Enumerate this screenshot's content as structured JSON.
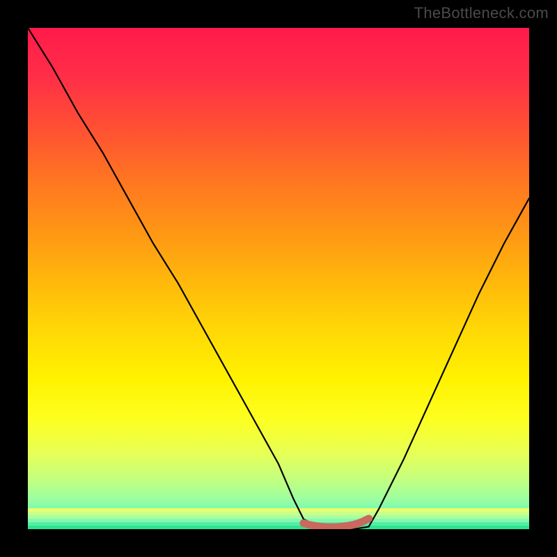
{
  "watermark": "TheBottleneck.com",
  "chart_data": {
    "type": "line",
    "title": "",
    "xlabel": "",
    "ylabel": "",
    "xlim": [
      0,
      100
    ],
    "ylim": [
      0,
      100
    ],
    "grid": false,
    "legend": false,
    "series": [
      {
        "name": "curve",
        "x": [
          0,
          5,
          10,
          15,
          20,
          25,
          30,
          35,
          40,
          45,
          50,
          53,
          55,
          58,
          60,
          62,
          65,
          68,
          70,
          75,
          80,
          85,
          90,
          95,
          100
        ],
        "values": [
          100,
          92,
          83,
          75,
          66,
          57,
          49,
          40,
          31,
          22,
          13,
          6,
          2,
          0.5,
          0,
          0,
          0,
          0.5,
          4,
          14,
          25,
          36,
          47,
          57,
          66
        ]
      },
      {
        "name": "flat-marker",
        "x": [
          55,
          56,
          57,
          58,
          59,
          60,
          61,
          62,
          63,
          64,
          65,
          66,
          67,
          68
        ],
        "values": [
          1.2,
          0.9,
          0.7,
          0.55,
          0.45,
          0.4,
          0.4,
          0.45,
          0.55,
          0.7,
          0.9,
          1.2,
          1.6,
          2.1
        ]
      }
    ],
    "gradient_bands": [
      {
        "stop": 0.0,
        "color": "#ff1a4b"
      },
      {
        "stop": 0.1,
        "color": "#ff2f47"
      },
      {
        "stop": 0.2,
        "color": "#ff5033"
      },
      {
        "stop": 0.3,
        "color": "#ff7422"
      },
      {
        "stop": 0.4,
        "color": "#ff9415"
      },
      {
        "stop": 0.5,
        "color": "#ffb60c"
      },
      {
        "stop": 0.6,
        "color": "#ffd706"
      },
      {
        "stop": 0.7,
        "color": "#fff200"
      },
      {
        "stop": 0.78,
        "color": "#fdff1f"
      },
      {
        "stop": 0.85,
        "color": "#e6ff57"
      },
      {
        "stop": 0.9,
        "color": "#c4ff7f"
      },
      {
        "stop": 0.94,
        "color": "#9cffa0"
      },
      {
        "stop": 0.97,
        "color": "#6cf7b4"
      },
      {
        "stop": 1.0,
        "color": "#2de58f"
      }
    ]
  }
}
